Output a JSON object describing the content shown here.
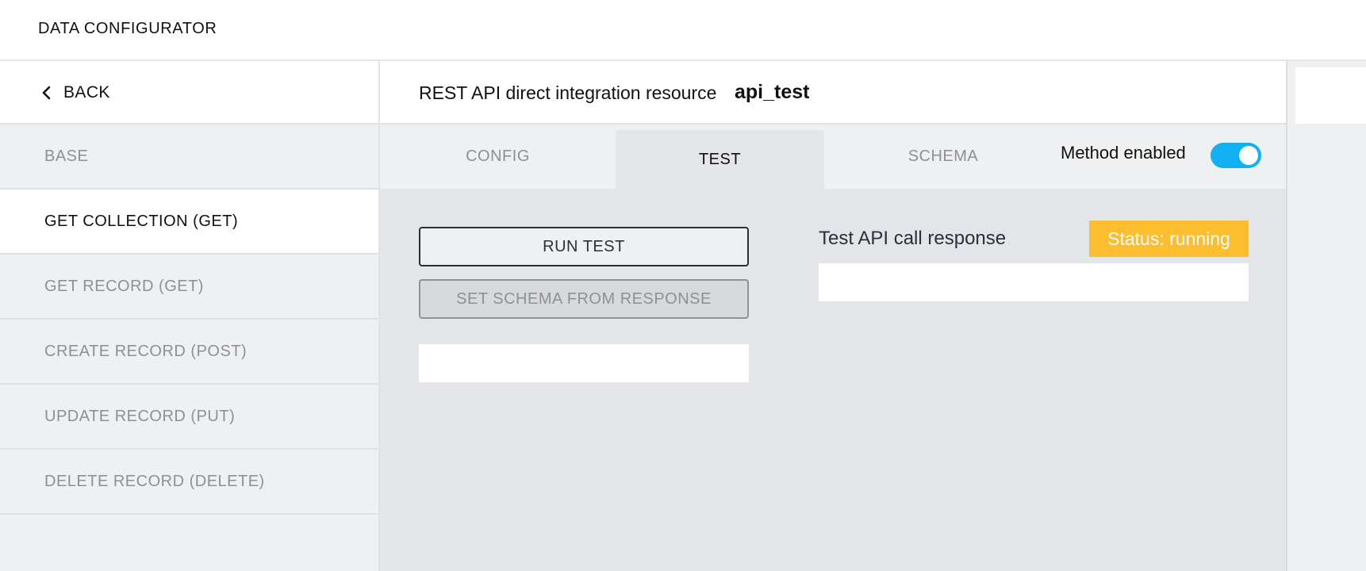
{
  "app": {
    "title": "DATA CONFIGURATOR"
  },
  "sidebar": {
    "back_label": "BACK",
    "items": [
      {
        "label": "BASE",
        "active": false
      },
      {
        "label": "GET COLLECTION (GET)",
        "active": true
      },
      {
        "label": "GET RECORD (GET)",
        "active": false
      },
      {
        "label": "CREATE RECORD (POST)",
        "active": false
      },
      {
        "label": "UPDATE RECORD (PUT)",
        "active": false
      },
      {
        "label": "DELETE RECORD (DELETE)",
        "active": false
      }
    ]
  },
  "resource": {
    "type_label": "REST API direct integration resource",
    "name": "api_test"
  },
  "tabs": [
    {
      "label": "CONFIG",
      "active": false
    },
    {
      "label": "TEST",
      "active": true
    },
    {
      "label": "SCHEMA",
      "active": false
    }
  ],
  "method_toggle": {
    "label": "Method enabled",
    "enabled": true,
    "color": "#11b0f2"
  },
  "test_panel": {
    "run_test_label": "RUN TEST",
    "set_schema_label": "SET SCHEMA FROM RESPONSE",
    "input_value": "",
    "response_title": "Test API call response",
    "status_text": "Status: running",
    "status_color": "#fcbd2e",
    "response_value": ""
  }
}
